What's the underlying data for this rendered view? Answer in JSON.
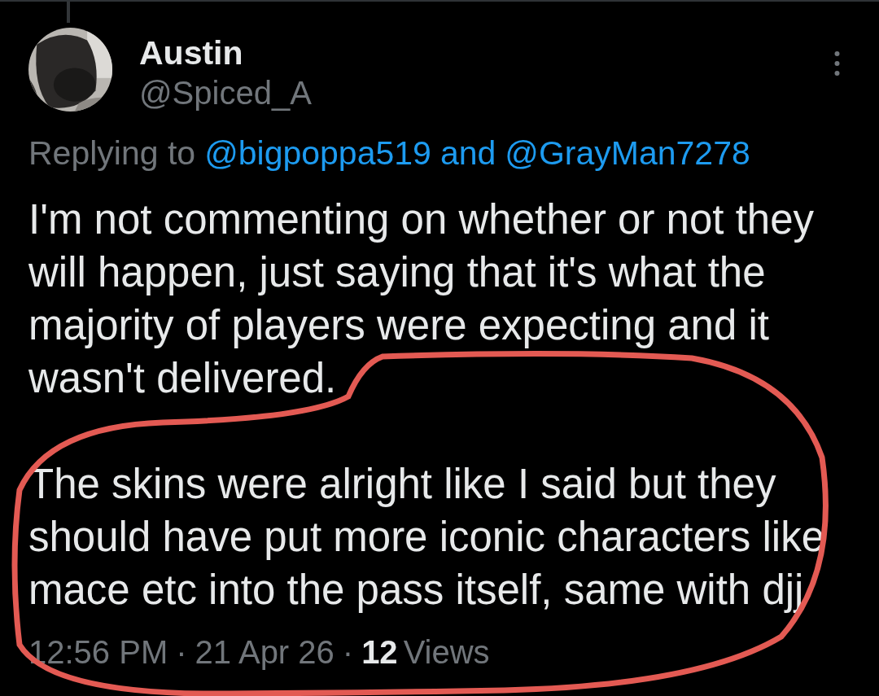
{
  "author": {
    "name": "Austin",
    "handle": "@Spiced_A"
  },
  "reply_context": {
    "prefix": "Replying to",
    "first_mention": "@bigpoppa519",
    "conjunction": "and",
    "second_mention": "@GrayMan7278"
  },
  "paragraphs": [
    "I'm not commenting on whether or not they\nwill happen, just saying that it's what the\nmajority of players were expecting and it\nwasn't delivered.",
    "The skins were alright like I said but they\nshould have put more iconic characters like\nmace etc into the pass itself, same with djj"
  ],
  "meta": {
    "time": "12:56 PM",
    "separator_1": "·",
    "date": "21 Apr 26",
    "separator_2": "·",
    "views_count": "12",
    "views_label": "Views"
  }
}
